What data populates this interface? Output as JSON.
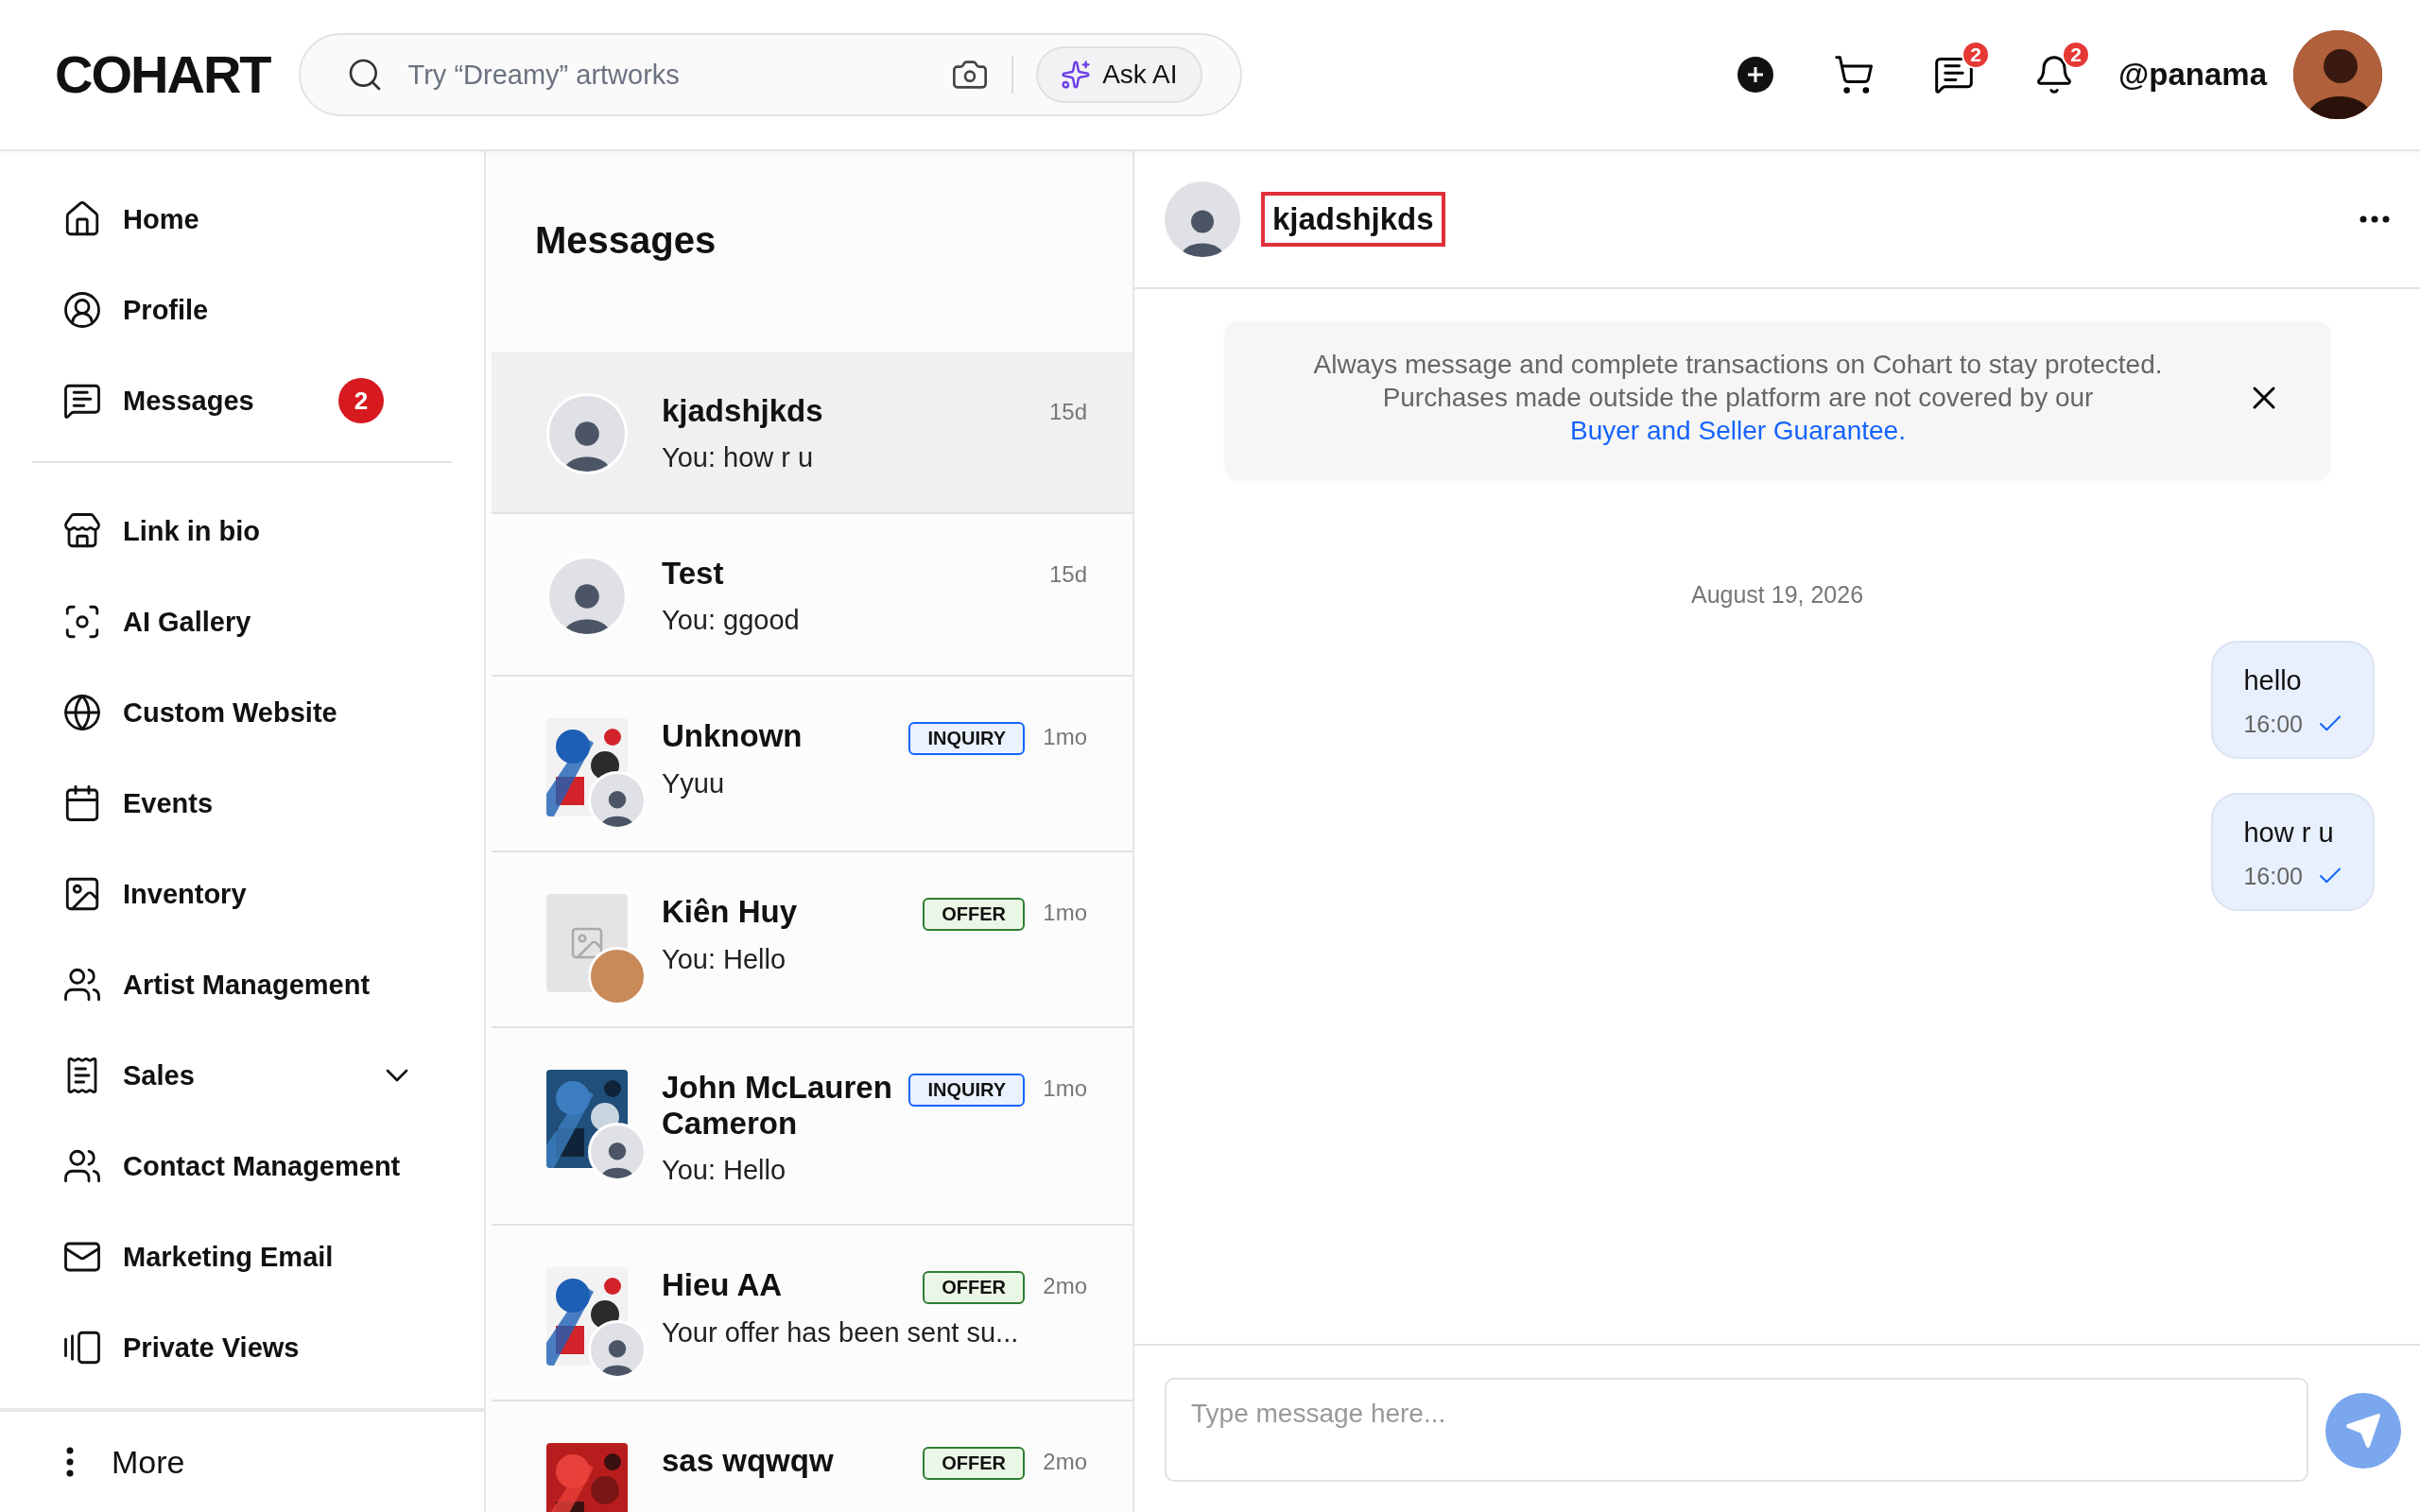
{
  "header": {
    "logo": "COHART",
    "search": {
      "placeholder": "Try “Dreamy” artworks",
      "ask_ai": "Ask AI"
    },
    "chat_badge": "2",
    "notification_badge": "2",
    "username": "@panama"
  },
  "sidebar": {
    "sections": [
      [
        {
          "label": "Home"
        },
        {
          "label": "Profile"
        },
        {
          "label": "Messages",
          "badge": "2"
        }
      ],
      [
        {
          "label": "Link in bio"
        },
        {
          "label": "AI Gallery"
        },
        {
          "label": "Custom Website"
        },
        {
          "label": "Events"
        },
        {
          "label": "Inventory"
        },
        {
          "label": "Artist Management"
        },
        {
          "label": "Sales",
          "expanded": false
        },
        {
          "label": "Contact Management"
        },
        {
          "label": "Marketing Email"
        },
        {
          "label": "Private Views"
        }
      ]
    ],
    "more": "More"
  },
  "conversation_list": {
    "title": "Messages",
    "rows": [
      {
        "name": "kjadshjkds",
        "time": "15d",
        "preview": "You: how r u",
        "selected": true,
        "avatar": {
          "kind": "person"
        }
      },
      {
        "name": "Test",
        "time": "15d",
        "preview": "You: ggood",
        "selected": false,
        "avatar": {
          "kind": "person"
        }
      },
      {
        "name": "Unknown",
        "time": "1mo",
        "preview": "Yyuu",
        "selected": false,
        "tag": {
          "label": "INQUIRY",
          "kind": "inquiry"
        },
        "avatar": {
          "kind": "artwork",
          "badge": {
            "kind": "person"
          }
        }
      },
      {
        "name": "Kiên Huy",
        "time": "1mo",
        "preview": "You: Hello",
        "selected": false,
        "tag": {
          "label": "OFFER",
          "kind": "offer"
        },
        "avatar": {
          "kind": "placeholder"
        }
      },
      {
        "name": "John McLauren Cameron",
        "time": "1mo",
        "preview": "You: Hello",
        "selected": false,
        "tag": {
          "label": "INQUIRY",
          "kind": "inquiry"
        },
        "avatar": {
          "kind": "artwork",
          "badge": {
            "kind": "person"
          }
        }
      },
      {
        "name": "Hieu AA",
        "time": "2mo",
        "preview": "Your offer has been sent su...",
        "selected": false,
        "tag": {
          "label": "OFFER",
          "kind": "offer"
        },
        "avatar": {
          "kind": "artwork",
          "badge": {
            "kind": "person"
          }
        }
      },
      {
        "name": "sas wqwqw",
        "time": "2mo",
        "selected": false,
        "tag": {
          "label": "OFFER",
          "kind": "offer"
        },
        "avatar": {
          "kind": "artwork"
        }
      }
    ]
  },
  "chat": {
    "contact": {
      "name": "kjadshjkds",
      "outlined": true
    },
    "notice": {
      "text": "Always message and complete transactions on Cohart to stay protected. Purchases made outside the platform are not covered by our",
      "link": "Buyer and Seller Guarantee."
    },
    "date": "August 19, 2026",
    "messages": [
      {
        "text": "hello",
        "time": "16:00",
        "read": true
      },
      {
        "text": "how r u",
        "time": "16:00",
        "read": true
      }
    ],
    "composer": {
      "placeholder": "Type message here..."
    }
  }
}
